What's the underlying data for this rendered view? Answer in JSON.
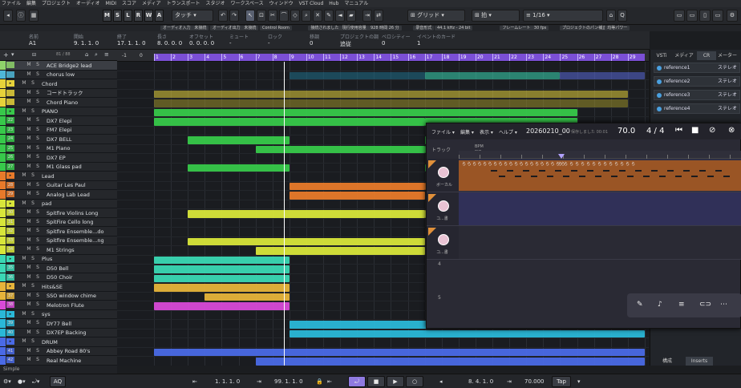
{
  "menu": [
    "ファイル",
    "編集",
    "プロジェクト",
    "オーディオ",
    "MIDI",
    "スコア",
    "メディア",
    "トランスポート",
    "スタジオ",
    "ワークスペース",
    "ウィンドウ",
    "VST Cloud",
    "Hub",
    "マニュアル"
  ],
  "toolbar": {
    "modes": [
      "M",
      "S",
      "L",
      "R",
      "W",
      "A"
    ],
    "touch_label": "タッチ",
    "grid_label": "グリッド",
    "quantize_label": "拍",
    "quantize_value": "1/16",
    "buttons": [
      "オーディオ入力",
      "未接続",
      "オーディオ出力",
      "未接続",
      "Control Room",
      "接続されました",
      "現行使用容量",
      "928 時間 26 分",
      "录音形式",
      "44.1 kHz - 24 bit",
      "フレームレート",
      "30 fps",
      "プロジェクトのパン補正",
      "均等パワー"
    ]
  },
  "infoline": {
    "labels": [
      "名前",
      "開始",
      "終了",
      "長さ",
      "オフセット",
      "ミュート",
      "ロック",
      "移調",
      "プロジェクトの調",
      "ベロシティー",
      "イベントのカード"
    ],
    "values": [
      "A1",
      "9. 1. 1.  0",
      "17. 1. 1.  0",
      "8. 0. 0.  0",
      "0. 0. 0.  0",
      "-",
      "-",
      "0",
      "追従",
      "0",
      "1"
    ]
  },
  "trackheader": {
    "counter": "81 / 88"
  },
  "tracks": [
    {
      "num": "",
      "name": "ACE Bridge2 lead",
      "color": "#8fd36a",
      "folder": false,
      "selected": true
    },
    {
      "num": "",
      "name": "chorus low",
      "color": "#4fb8d8",
      "folder": false,
      "selected": false
    },
    {
      "num": "",
      "name": "Chord",
      "color": "#e6d23a",
      "folder": true,
      "selected": false
    },
    {
      "num": "",
      "name": "コードトラック",
      "color": "#e6d23a",
      "folder": false,
      "selected": false
    },
    {
      "num": "",
      "name": "Chord Piano",
      "color": "#e6d23a",
      "folder": false,
      "selected": false
    },
    {
      "num": "",
      "name": "PIANO",
      "color": "#37c94a",
      "folder": true,
      "selected": false
    },
    {
      "num": "22",
      "name": "DX7 Elepi",
      "color": "#37c94a",
      "folder": false,
      "selected": false
    },
    {
      "num": "23",
      "name": "FM7 Elepi",
      "color": "#37c94a",
      "folder": false,
      "selected": false
    },
    {
      "num": "24",
      "name": "DX7 BELL",
      "color": "#37c94a",
      "folder": false,
      "selected": false
    },
    {
      "num": "25",
      "name": "M1 Piano",
      "color": "#37c94a",
      "folder": false,
      "selected": false
    },
    {
      "num": "26",
      "name": "DX7 EP",
      "color": "#37c94a",
      "folder": false,
      "selected": false
    },
    {
      "num": "27",
      "name": "M1 Glass pad",
      "color": "#37c94a",
      "folder": false,
      "selected": false
    },
    {
      "num": "",
      "name": "Lead",
      "color": "#e87a2a",
      "folder": true,
      "selected": false
    },
    {
      "num": "28",
      "name": "Guitar Les Paul",
      "color": "#e87a2a",
      "folder": false,
      "selected": false
    },
    {
      "num": "29",
      "name": "Analog Lab Lead",
      "color": "#e87a2a",
      "folder": false,
      "selected": false
    },
    {
      "num": "",
      "name": "pad",
      "color": "#d8e63a",
      "folder": true,
      "selected": false
    },
    {
      "num": "30",
      "name": "Spitfire Violins Long",
      "color": "#d8e63a",
      "folder": false,
      "selected": false
    },
    {
      "num": "31",
      "name": "SpitFire Cello long",
      "color": "#d8e63a",
      "folder": false,
      "selected": false
    },
    {
      "num": "32",
      "name": "Spitfire Ensemble...do",
      "color": "#d8e63a",
      "folder": false,
      "selected": false
    },
    {
      "num": "33",
      "name": "Spitfire Ensemble...ng",
      "color": "#d8e63a",
      "folder": false,
      "selected": false
    },
    {
      "num": "34",
      "name": "M1  Strings",
      "color": "#d8e63a",
      "folder": false,
      "selected": false
    },
    {
      "num": "",
      "name": "Plus",
      "color": "#3ad8b4",
      "folder": true,
      "selected": false
    },
    {
      "num": "35",
      "name": "D50 Bell",
      "color": "#3ad8b4",
      "folder": false,
      "selected": false
    },
    {
      "num": "36",
      "name": "D50 Choir",
      "color": "#3ad8b4",
      "folder": false,
      "selected": false
    },
    {
      "num": "",
      "name": "Hits&SE",
      "color": "#e6b43a",
      "folder": true,
      "selected": false
    },
    {
      "num": "37",
      "name": "SSO window chime",
      "color": "#e6b43a",
      "folder": false,
      "selected": false
    },
    {
      "num": "38",
      "name": "Melotron Flute",
      "color": "#d84ad8",
      "folder": false,
      "selected": false
    },
    {
      "num": "",
      "name": "sys",
      "color": "#2ab8d8",
      "folder": true,
      "selected": false
    },
    {
      "num": "39",
      "name": "DY77 Bell",
      "color": "#2ab8d8",
      "folder": false,
      "selected": false
    },
    {
      "num": "40",
      "name": "DX7EP  Backing",
      "color": "#2ab8d8",
      "folder": false,
      "selected": false
    },
    {
      "num": "",
      "name": "DRUM",
      "color": "#4a6ae6",
      "folder": true,
      "selected": false
    },
    {
      "num": "41",
      "name": "Abbey Road 80's",
      "color": "#4a6ae6",
      "folder": false,
      "selected": false
    },
    {
      "num": "42",
      "name": "Real Machine",
      "color": "#4a6ae6",
      "folder": false,
      "selected": false
    }
  ],
  "track_buttons": {
    "mute": "M",
    "solo": "S"
  },
  "ruler": {
    "start_labels": [
      "-1",
      "0"
    ],
    "bars": [
      "1",
      "2",
      "3",
      "4",
      "5",
      "6",
      "7",
      "8",
      "9",
      "10",
      "11",
      "12",
      "13",
      "14",
      "15",
      "16",
      "17",
      "18",
      "19",
      "20",
      "21",
      "22",
      "23",
      "24",
      "25",
      "26",
      "27",
      "28",
      "29"
    ]
  },
  "right_panel": {
    "tabs": [
      "VSTi",
      "メディア",
      "CR",
      "メーター"
    ],
    "monitor_label": "Monitor",
    "refs": [
      {
        "name": "reference1",
        "mode": "ステレオ"
      },
      {
        "name": "reference2",
        "mode": "ステレオ"
      },
      {
        "name": "reference3",
        "mode": "ステレオ"
      },
      {
        "name": "reference4",
        "mode": "ステレオ"
      }
    ],
    "bottom_tabs": [
      "構成",
      "Inserts"
    ]
  },
  "overlay": {
    "menu": [
      "ファイル ▾",
      "編集 ▾",
      "表示 ▾",
      "ヘルプ ▾"
    ],
    "project_name": "20260210_00",
    "save_hint": "保存しました 00:01",
    "tempo": "70.0",
    "time_sig": "4 / 4",
    "side_label": "トラック",
    "bpm_label": "BPM",
    "sig_label": "SIG.",
    "lyric_syllable": "ら",
    "voice_tracks": [
      {
        "label": "ボーカル",
        "color": "#e0903a"
      },
      {
        "label": "コ...書",
        "color": "#e0903a"
      },
      {
        "label": "コ...書",
        "color": "#e0903a"
      }
    ],
    "row_numbers": [
      "4",
      "5"
    ],
    "tool_icons": [
      "wrench",
      "mic",
      "sliders",
      "link",
      "dots"
    ]
  },
  "transport": {
    "left_position": "1. 1. 1.  0",
    "right_position": "99. 1. 1.  0",
    "play_position": "8. 4. 1.  0",
    "tempo": "70.000",
    "tap_label": "Tap",
    "aq_label": "AQ"
  },
  "statusbar": {
    "preset": "Simple"
  },
  "colors": {
    "ruler_bar": "#7b4fd6",
    "selection": "#3b3e44",
    "accent": "#4aa0e0"
  }
}
